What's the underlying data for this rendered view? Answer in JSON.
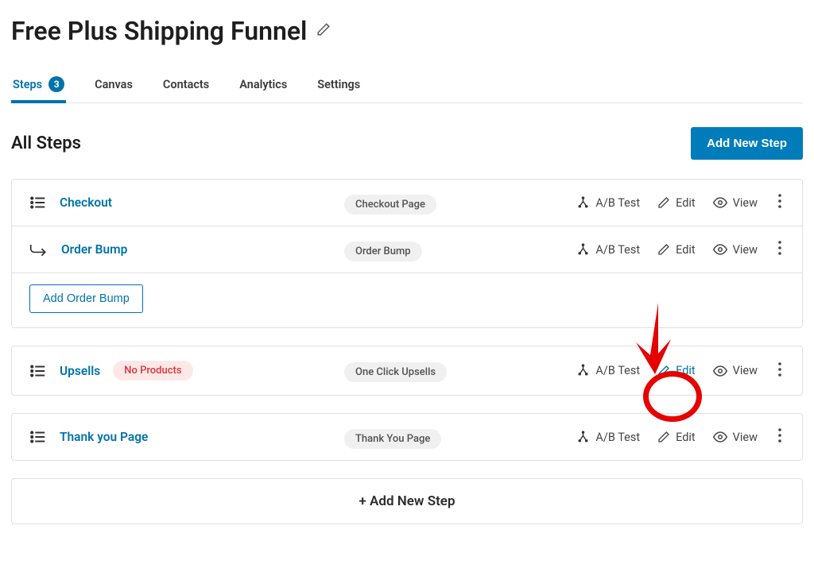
{
  "page": {
    "title": "Free Plus Shipping Funnel"
  },
  "tabs": [
    {
      "label": "Steps",
      "badge": "3",
      "active": true
    },
    {
      "label": "Canvas"
    },
    {
      "label": "Contacts"
    },
    {
      "label": "Analytics"
    },
    {
      "label": "Settings"
    }
  ],
  "section": {
    "title": "All Steps",
    "add_button": "Add New Step",
    "add_bar": "+ Add New Step",
    "add_order_bump": "Add Order Bump"
  },
  "actions": {
    "ab_test": "A/B Test",
    "edit": "Edit",
    "view": "View"
  },
  "steps": [
    {
      "name": "Checkout",
      "type_label": "Checkout Page",
      "sub": {
        "name": "Order Bump",
        "type_label": "Order Bump"
      }
    },
    {
      "name": "Upsells",
      "warn": "No Products",
      "type_label": "One Click Upsells",
      "highlight_edit": true
    },
    {
      "name": "Thank you Page",
      "type_label": "Thank You Page"
    }
  ]
}
